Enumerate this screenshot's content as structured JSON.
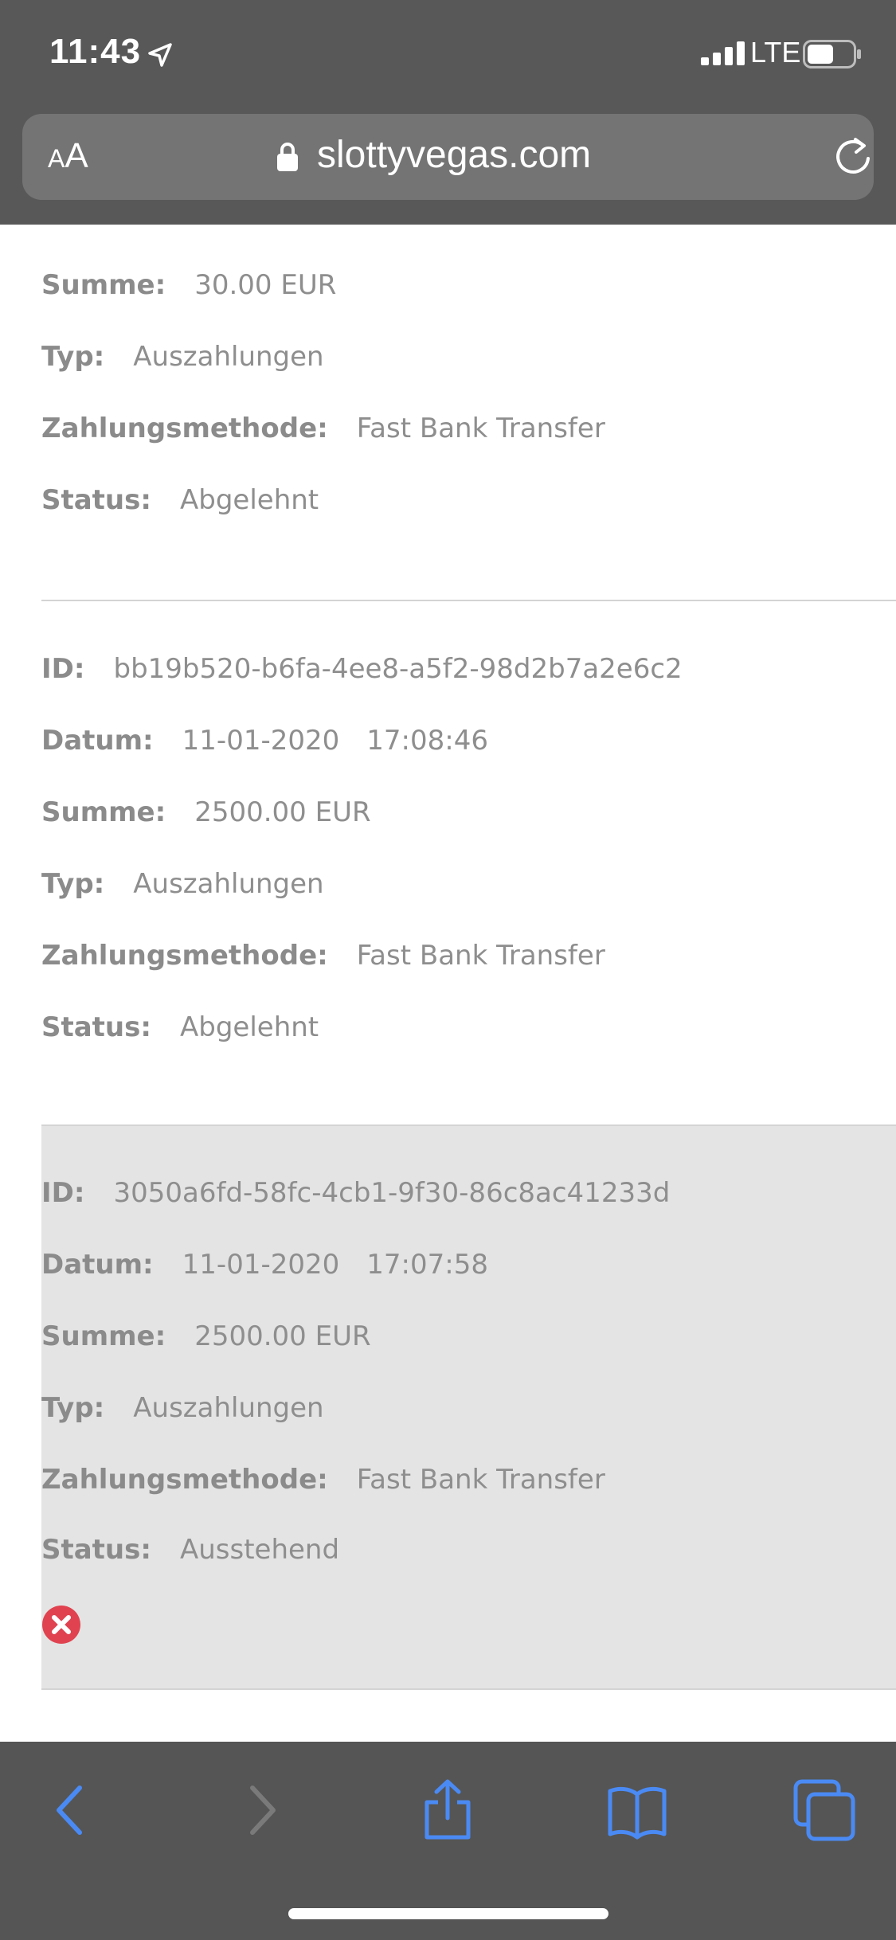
{
  "status_bar": {
    "time": "11:43",
    "network": "LTE"
  },
  "browser": {
    "text_size_small": "A",
    "text_size_large": "A",
    "url": "slottyvegas.com"
  },
  "labels": {
    "id": "ID:",
    "date": "Datum:",
    "amount": "Summe:",
    "type": "Typ:",
    "method": "Zahlungsmethode:",
    "status": "Status:"
  },
  "transactions": [
    {
      "amount": "30.00 EUR",
      "type": "Auszahlungen",
      "method": "Fast Bank Transfer",
      "status": "Abgelehnt"
    },
    {
      "id": "bb19b520-b6fa-4ee8-a5f2-98d2b7a2e6c2",
      "date": "11-01-2020",
      "time": "17:08:46",
      "amount": "2500.00 EUR",
      "type": "Auszahlungen",
      "method": "Fast Bank Transfer",
      "status": "Abgelehnt"
    },
    {
      "id": "3050a6fd-58fc-4cb1-9f30-86c8ac41233d",
      "date": "11-01-2020",
      "time": "17:07:58",
      "amount": "2500.00 EUR",
      "type": "Auszahlungen",
      "method": "Fast Bank Transfer",
      "status": "Ausstehend"
    }
  ],
  "colors": {
    "chrome_bg": "#585858",
    "toolbar_icon": "#4a8af4",
    "toolbar_icon_disabled": "#7a7a7a",
    "cancel_red": "#e0424f",
    "highlight_bg": "#e4e4e4"
  },
  "icons": {
    "location": "location-arrow-icon",
    "signal": "cellular-signal-icon",
    "battery": "battery-icon",
    "lock": "lock-icon",
    "reload": "reload-icon",
    "cancel": "cancel-x-icon",
    "back": "back-chevron-icon",
    "forward": "forward-chevron-icon",
    "share": "share-icon",
    "bookmarks": "bookmarks-book-icon",
    "tabs": "tabs-icon"
  }
}
